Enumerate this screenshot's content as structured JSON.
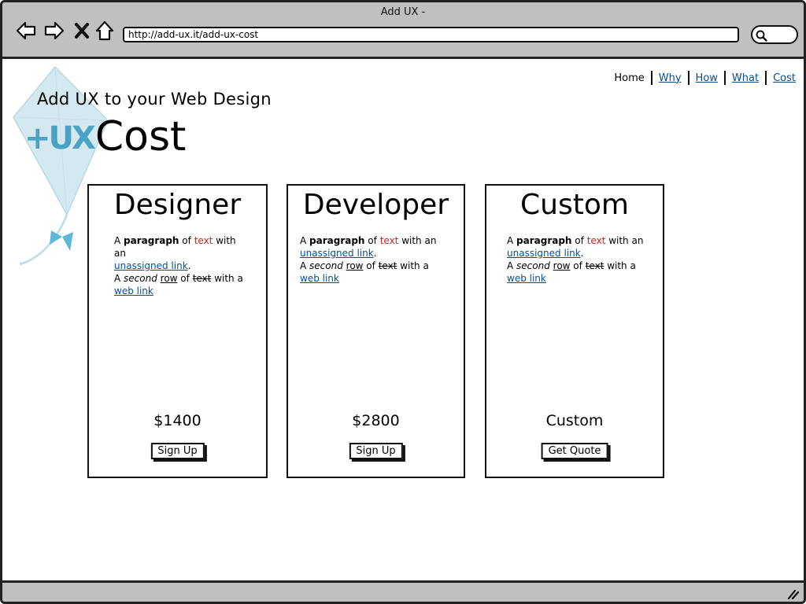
{
  "window": {
    "title": "Add UX -"
  },
  "browser": {
    "url": "http://add-ux.it/add-ux-cost"
  },
  "nav": {
    "items": [
      {
        "label": "Home"
      },
      {
        "label": "Why"
      },
      {
        "label": "How"
      },
      {
        "label": "What"
      },
      {
        "label": "Cost"
      }
    ]
  },
  "header": {
    "tagline": "Add UX to your Web Design",
    "logo": "+UX",
    "title": "Cost"
  },
  "cards": [
    {
      "title": "Designer",
      "para": {
        "a": "A ",
        "bold": "paragraph",
        "of": " of ",
        "red": "text",
        "with_an": " with an ",
        "link1": "unassigned link",
        "dot": ".",
        "a2": "A ",
        "italic": "second",
        "sp": " ",
        "row": "row",
        "of2": " of ",
        "strike": "text",
        "with_a": " with a ",
        "link2": "web link"
      },
      "price": "$1400",
      "button": "Sign Up"
    },
    {
      "title": "Developer",
      "para": {
        "a": "A ",
        "bold": "paragraph",
        "of": " of ",
        "red": "text",
        "with_an": " with an ",
        "link1": "unassigned link",
        "dot": ".",
        "a2": "A ",
        "italic": "second",
        "sp": " ",
        "row": "row",
        "of2": " of ",
        "strike": "text",
        "with_a": " with a ",
        "link2": "web link"
      },
      "price": "$2800",
      "button": "Sign Up"
    },
    {
      "title": "Custom",
      "para": {
        "a": "A ",
        "bold": "paragraph",
        "of": " of ",
        "red": "text",
        "with_an": " with an ",
        "link1": "unassigned link",
        "dot": ".",
        "a2": "A ",
        "italic": "second",
        "sp": " ",
        "row": "row",
        "of2": " of ",
        "strike": "text",
        "with_a": " with a ",
        "link2": "web link"
      },
      "price": "Custom",
      "button": "Get Quote"
    }
  ],
  "colors": {
    "link": "#0a4d8c",
    "emphasis": "#d21f1f",
    "logo": "#4aa3c4",
    "chrome": "#c0c0c0"
  }
}
